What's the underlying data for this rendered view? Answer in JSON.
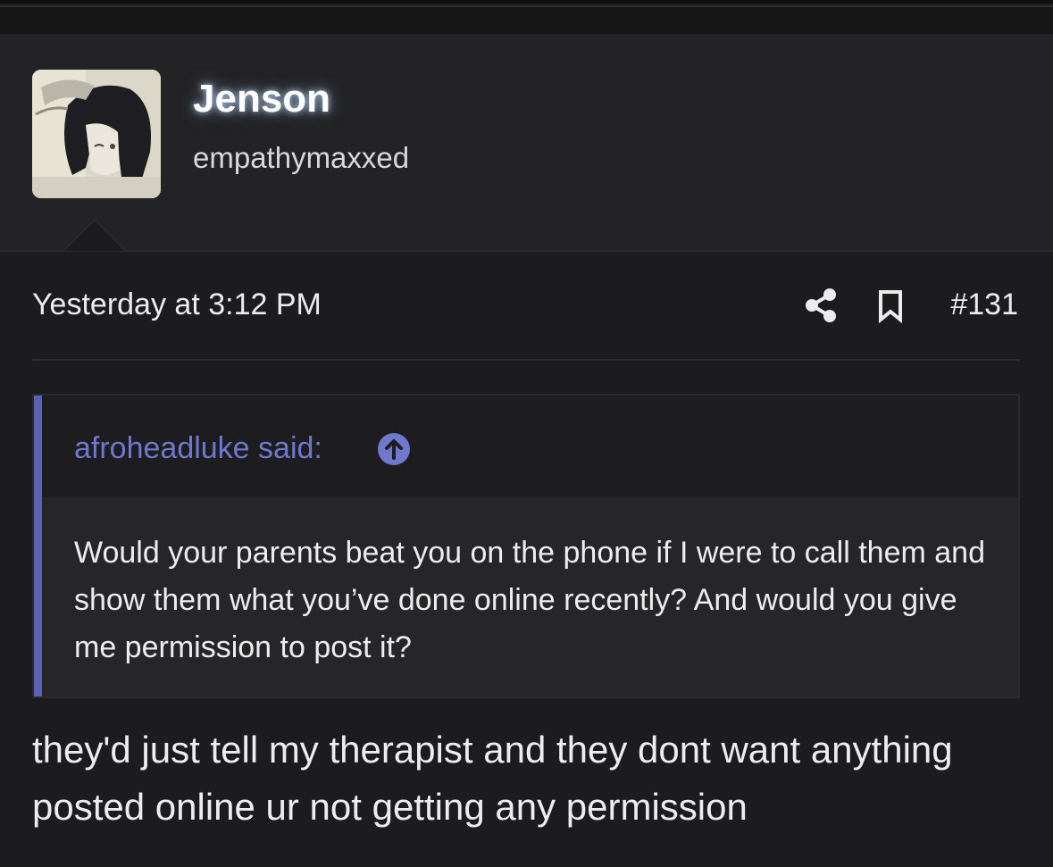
{
  "user": {
    "name": "Jenson",
    "title": "empathymaxxed",
    "avatar_icon": "anime-avatar-icon"
  },
  "post": {
    "timestamp": "Yesterday at 3:12 PM",
    "number": "#131",
    "share_icon": "share-icon",
    "bookmark_icon": "bookmark-icon"
  },
  "quote": {
    "author_label": "afroheadluke said:",
    "jump_icon": "arrow-up-circle-icon",
    "accent_color": "#5a63b3",
    "body": "Would your parents beat you on the phone if I were to call them and show them what you’ve done online recently? And would you give me permission to post it?"
  },
  "reply": {
    "body": "they'd just tell my therapist and they dont want anything posted online ur not getting any permission"
  }
}
